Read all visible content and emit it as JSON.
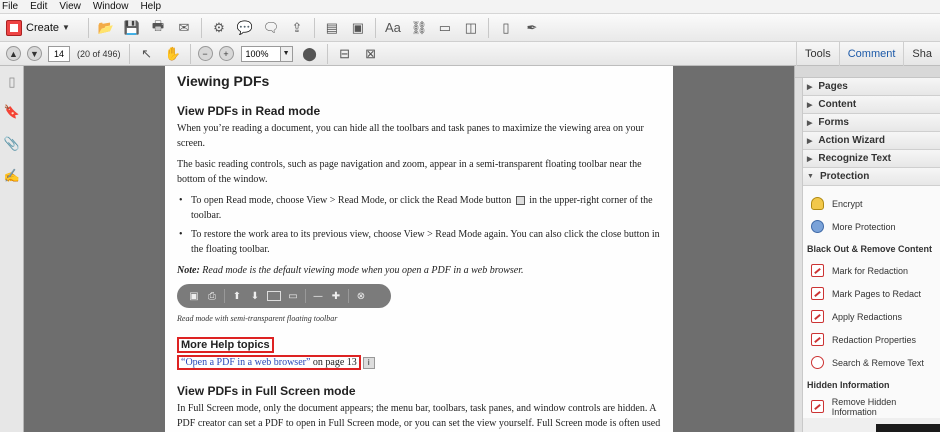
{
  "menu": [
    "File",
    "Edit",
    "View",
    "Window",
    "Help"
  ],
  "toolbar": {
    "create_label": "Create",
    "icons": [
      "open-folder-icon",
      "save-icon",
      "print-icon",
      "email-icon",
      "settings-icon",
      "comment-icon",
      "stamp-icon",
      "share-icon",
      "combine-icon",
      "text-icon",
      "link-icon",
      "form-icon",
      "sign-icon",
      "export-icon"
    ]
  },
  "nav": {
    "page_number": "14",
    "page_count": "(20 of 496)",
    "zoom": "100%"
  },
  "right_tabs": [
    "Tools",
    "Comment",
    "Sha"
  ],
  "document": {
    "heading": "Viewing PDFs",
    "section1_title": "View PDFs in Read mode",
    "p1": "When you’re reading a document, you can hide all the toolbars and task panes to maximize the viewing area on your screen.",
    "p2": "The basic reading controls, such as page navigation and zoom, appear in a semi-transparent floating toolbar near the bottom of the window.",
    "bullet1_a": "To open Read mode, choose View > Read Mode, or click the Read Mode button",
    "bullet1_b": "in the upper-right corner of the toolbar.",
    "bullet2": "To restore the work area to its previous view, choose View > Read Mode again. You can also click the close button in the floating toolbar.",
    "note_label": "Note:",
    "note_text": "Read mode is the default viewing mode when you open a PDF in a web browser.",
    "caption": "Read mode with semi-transparent floating toolbar",
    "help_title": "More Help topics",
    "help_link": "“Open a PDF in a web browser”",
    "help_link_page": "on page 13",
    "section2_title": "View PDFs in Full Screen mode",
    "p3": "In Full Screen mode, only the document appears; the menu bar, toolbars, task panes, and window controls are hidden. A PDF creator can set a PDF to open in Full Screen mode, or you can set the view yourself. Full Screen mode is often used for presentations, sometimes with automatic page advancement and transitions."
  },
  "panel": {
    "sections": [
      "Pages",
      "Content",
      "Forms",
      "Action Wizard",
      "Recognize Text",
      "Protection"
    ],
    "protection_items": [
      "Encrypt",
      "More Protection"
    ],
    "blackout_header": "Black Out & Remove Content",
    "blackout_items": [
      "Mark for Redaction",
      "Mark Pages to Redact",
      "Apply Redactions",
      "Redaction Properties",
      "Search & Remove Text"
    ],
    "hidden_header": "Hidden Information",
    "hidden_items": [
      "Remove Hidden Information"
    ]
  }
}
